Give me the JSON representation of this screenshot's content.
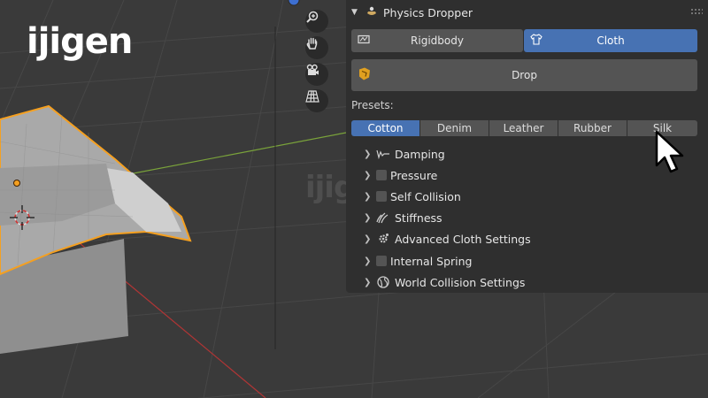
{
  "logo": {
    "text": "ijigen"
  },
  "watermark": {
    "text": "ijigen"
  },
  "panel": {
    "title": "Physics Dropper",
    "mode_buttons": [
      {
        "label": "Rigidbody",
        "icon": "rigidbody-icon",
        "active": false
      },
      {
        "label": "Cloth",
        "icon": "shirt-icon",
        "active": true
      }
    ],
    "drop_label": "Drop",
    "presets_label": "Presets:",
    "presets": [
      "Cotton",
      "Denim",
      "Leather",
      "Rubber",
      "Silk"
    ],
    "active_preset": "Cotton",
    "subpanels": [
      {
        "label": "Damping",
        "icon": "damping-icon",
        "checkbox": false
      },
      {
        "label": "Pressure",
        "icon": "",
        "checkbox": true
      },
      {
        "label": "Self Collision",
        "icon": "",
        "checkbox": true
      },
      {
        "label": "Stiffness",
        "icon": "stiffness-icon",
        "checkbox": false
      },
      {
        "label": "Advanced Cloth Settings",
        "icon": "gear-icon",
        "checkbox": false
      },
      {
        "label": "Internal Spring",
        "icon": "",
        "checkbox": true
      },
      {
        "label": "World Collision Settings",
        "icon": "globe-icon",
        "checkbox": false
      }
    ]
  },
  "navigation": [
    "zoom-icon",
    "hand-icon",
    "camera-icon",
    "grid-icon"
  ],
  "colors": {
    "accent": "#4772b3",
    "panel_bg": "#2f2f2f",
    "button_bg": "#545454",
    "selection_outline": "#f5a020"
  }
}
